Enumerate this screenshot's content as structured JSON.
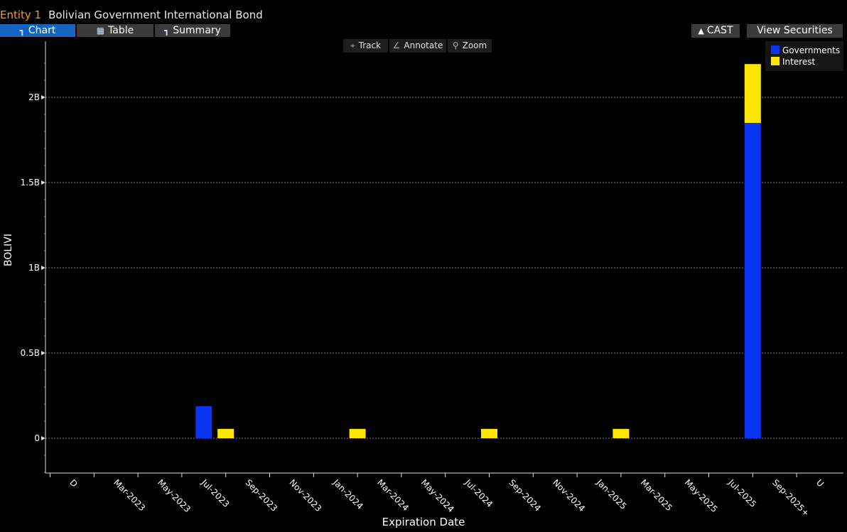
{
  "header": {
    "entity": "Entity 1",
    "name": "Bolivian Government International Bond"
  },
  "tabs": [
    {
      "label": "Chart",
      "icon": "line-chart-icon"
    },
    {
      "label": "Table",
      "icon": "table-icon"
    },
    {
      "label": "Summary",
      "icon": "summary-icon"
    }
  ],
  "tools": [
    {
      "label": "Track",
      "icon": "crosshair-icon"
    },
    {
      "label": "Annotate",
      "icon": "pencil-icon"
    },
    {
      "label": "Zoom",
      "icon": "magnifier-icon"
    }
  ],
  "right_buttons": {
    "cast": "CAST",
    "view": "View Securities"
  },
  "colors": {
    "governments": "#0a35f0",
    "interest": "#ffe600",
    "active_tab": "#1565c0"
  },
  "chart_data": {
    "type": "bar",
    "stacked": true,
    "ylabel": "BOLIVI",
    "xlabel": "Expiration Date",
    "ylim": [
      -0.2,
      2.3
    ],
    "yticks": [
      {
        "v": 0,
        "label": "0"
      },
      {
        "v": 0.5,
        "label": "0.5B"
      },
      {
        "v": 1,
        "label": "1B"
      },
      {
        "v": 1.5,
        "label": "1.5B"
      },
      {
        "v": 2,
        "label": "2B"
      }
    ],
    "x_tick_labels": [
      "D",
      "Mar-2023",
      "May-2023",
      "Jul-2023",
      "Sep-2023",
      "Nov-2023",
      "Jan-2024",
      "Mar-2024",
      "May-2024",
      "Jul-2024",
      "Sep-2024",
      "Nov-2024",
      "Jan-2025",
      "Mar-2025",
      "May-2025",
      "Jul-2025",
      "Sep-2025+",
      "U"
    ],
    "legend": "top-right",
    "grid": true,
    "series": [
      {
        "name": "Governments",
        "color": "#0a35f0"
      },
      {
        "name": "Interest",
        "color": "#ffe600"
      }
    ],
    "bars": [
      {
        "x": "Aug-2023",
        "values": [
          0.188,
          0
        ]
      },
      {
        "x": "Sep-2023",
        "values": [
          0,
          0.055
        ]
      },
      {
        "x": "Mar-2024",
        "values": [
          0,
          0.055
        ]
      },
      {
        "x": "Sep-2024",
        "values": [
          0,
          0.055
        ]
      },
      {
        "x": "Mar-2025",
        "values": [
          0,
          0.055
        ]
      },
      {
        "x": "Sep-2025+",
        "values": [
          1.85,
          0.345
        ]
      }
    ]
  }
}
